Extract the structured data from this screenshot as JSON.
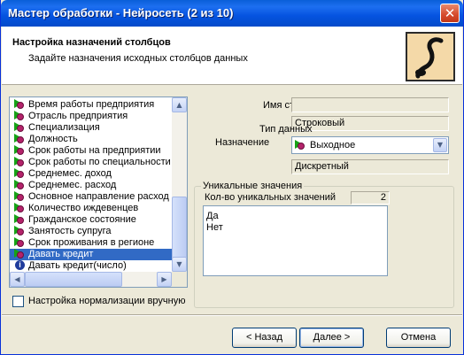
{
  "window": {
    "title": "Мастер обработки - Нейросеть (2 из 10)",
    "close_glyph": "✕"
  },
  "header": {
    "title": "Настройка назначений столбцов",
    "subtitle": "Задайте назначения исходных столбцов данных",
    "logo_icon": "script-s-logo-icon"
  },
  "columns": [
    {
      "label": "Время работы предприятия",
      "icon": "input-icon"
    },
    {
      "label": "Отрасль предприятия",
      "icon": "input-icon"
    },
    {
      "label": "Специализация",
      "icon": "input-icon"
    },
    {
      "label": "Должность",
      "icon": "input-icon"
    },
    {
      "label": "Срок работы на предприятии",
      "icon": "input-icon"
    },
    {
      "label": "Срок работы по специальности",
      "icon": "input-icon"
    },
    {
      "label": "Среднемес. доход",
      "icon": "input-icon"
    },
    {
      "label": "Среднемес. расход",
      "icon": "input-icon"
    },
    {
      "label": "Основное направление расход",
      "icon": "input-icon"
    },
    {
      "label": "Количество иждевенцев",
      "icon": "input-icon"
    },
    {
      "label": "Гражданское состояние",
      "icon": "input-icon"
    },
    {
      "label": "Занятость супруга",
      "icon": "input-icon"
    },
    {
      "label": "Срок проживания в регионе",
      "icon": "input-icon"
    },
    {
      "label": "Давать кредит",
      "icon": "output-icon",
      "selected": true
    },
    {
      "label": "Давать кредит(число)",
      "icon": "info-icon"
    }
  ],
  "normalization": {
    "label": "Настройка нормализации вручную",
    "checked": false
  },
  "properties": {
    "name_label": "Имя столбца",
    "name_value": "",
    "type_label": "Тип данных",
    "type_value": "Строковый",
    "purpose_label": "Назначение",
    "purpose_value": "Выходное",
    "kind_value": "Дискретный"
  },
  "unique": {
    "title": "Уникальные значения",
    "count_label": "Кол-во уникальных значений",
    "count_value": "2",
    "values": [
      "Да",
      "Нет"
    ]
  },
  "buttons": {
    "back": "< Назад",
    "next": "Далее >",
    "cancel": "Отмена"
  },
  "colors": {
    "title_bar": "#0553e0",
    "selection": "#316ac5",
    "dialog_bg": "#ece9d8",
    "input_icon": "#17a317",
    "output_icon": "#b4236b"
  }
}
